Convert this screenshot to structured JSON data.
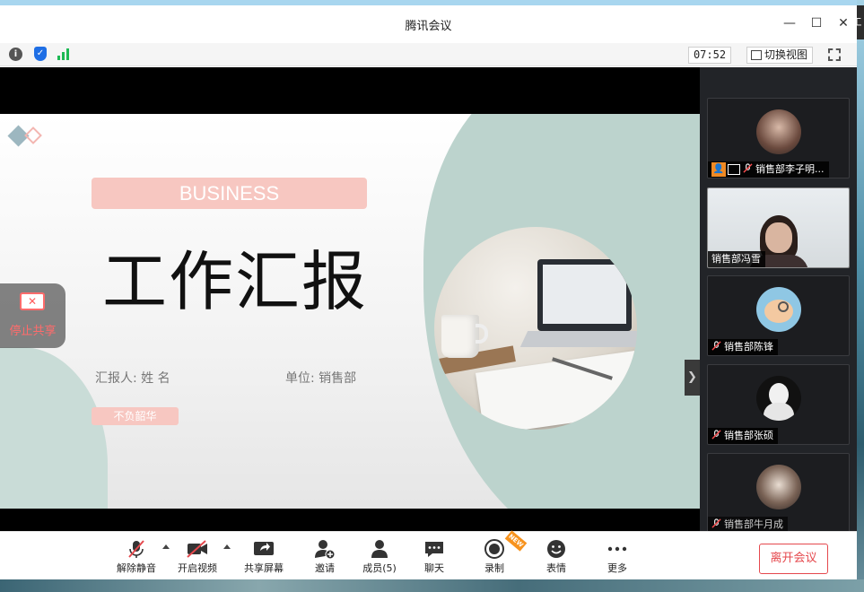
{
  "window": {
    "title": "腾讯会议"
  },
  "infobar": {
    "info_icon": "info-icon",
    "shield_icon": "shield-icon",
    "signal_icon": "signal-bars-icon",
    "timer": "07:52",
    "switch_view_label": "切换视图"
  },
  "corner_tab_label": "工",
  "slide": {
    "pill_text": "BUSINESS",
    "title": "工作汇报",
    "reporter": "汇报人: 姓 名",
    "unit": "单位: 销售部",
    "tag": "不负韶华"
  },
  "stop_share": {
    "label": "停止共享"
  },
  "gallery": {
    "participants": [
      {
        "name": "销售部李子明...",
        "host": true,
        "sharing": true,
        "muted": true
      },
      {
        "name": "销售部冯雪",
        "host": false,
        "sharing": false,
        "muted": false
      },
      {
        "name": "销售部陈锋",
        "host": false,
        "sharing": false,
        "muted": true
      },
      {
        "name": "销售部张硕",
        "host": false,
        "sharing": false,
        "muted": true
      },
      {
        "name": "销售部牛月成",
        "host": false,
        "sharing": false,
        "muted": true
      }
    ]
  },
  "toolbar": {
    "unmute": "解除静音",
    "video": "开启视频",
    "share": "共享屏幕",
    "invite": "邀请",
    "members": "成员(5)",
    "chat": "聊天",
    "record": "录制",
    "record_badge": "NEW",
    "emoji": "表情",
    "more": "更多",
    "leave": "离开会议"
  },
  "colors": {
    "accent_red": "#e5484d",
    "slide_pink": "#f7c7c1",
    "slide_teal": "#bcd3cd"
  }
}
